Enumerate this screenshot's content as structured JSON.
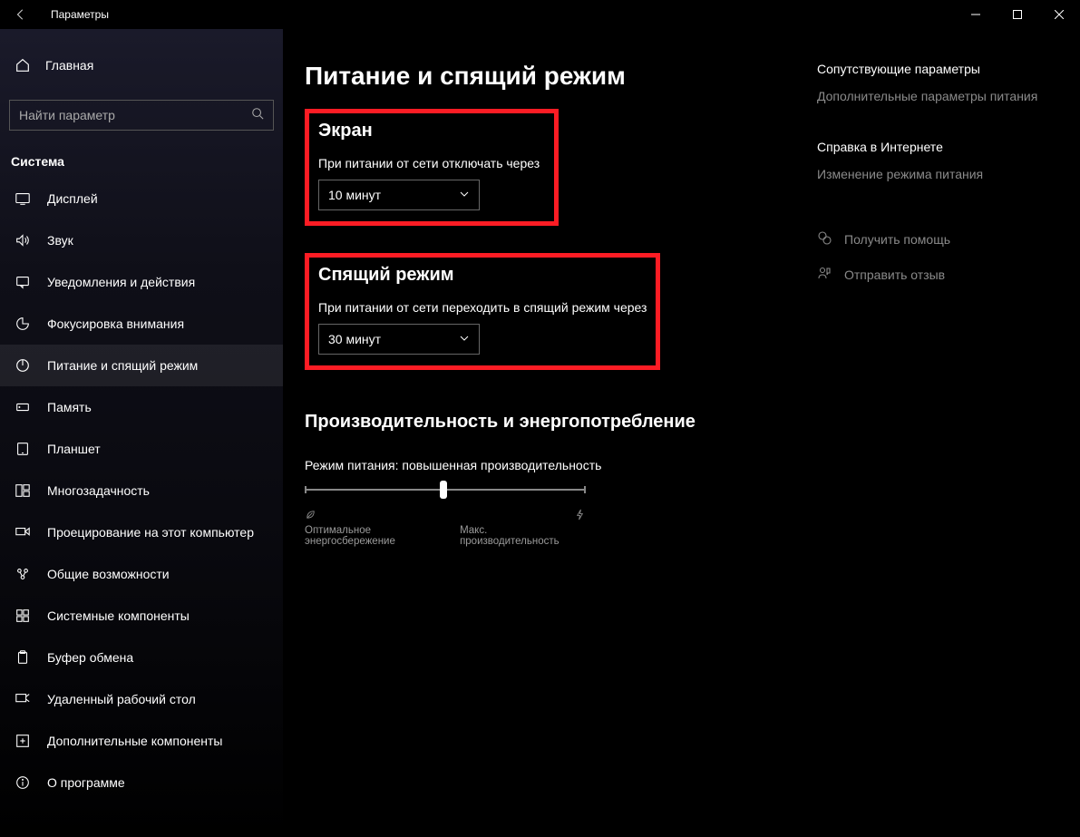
{
  "titlebar": {
    "title": "Параметры"
  },
  "sidebar": {
    "home": "Главная",
    "search_placeholder": "Найти параметр",
    "section": "Система",
    "items": [
      {
        "label": "Дисплей"
      },
      {
        "label": "Звук"
      },
      {
        "label": "Уведомления и действия"
      },
      {
        "label": "Фокусировка внимания"
      },
      {
        "label": "Питание и спящий режим"
      },
      {
        "label": "Память"
      },
      {
        "label": "Планшет"
      },
      {
        "label": "Многозадачность"
      },
      {
        "label": "Проецирование на этот компьютер"
      },
      {
        "label": "Общие возможности"
      },
      {
        "label": "Системные компоненты"
      },
      {
        "label": "Буфер обмена"
      },
      {
        "label": "Удаленный рабочий стол"
      },
      {
        "label": "Дополнительные компоненты"
      },
      {
        "label": "О программе"
      }
    ]
  },
  "page": {
    "title": "Питание и спящий режим",
    "screen": {
      "heading": "Экран",
      "label": "При питании от сети отключать через",
      "value": "10 минут"
    },
    "sleep": {
      "heading": "Спящий режим",
      "label": "При питании от сети переходить в спящий режим через",
      "value": "30 минут"
    },
    "perf": {
      "heading": "Производительность и энергопотребление",
      "mode_label": "Режим питания: повышенная производительность",
      "left_label": "Оптимальное энергосбережение",
      "right_label": "Макс. производительность"
    }
  },
  "right": {
    "related_heading": "Сопутствующие параметры",
    "related_link": "Дополнительные параметры питания",
    "help_heading": "Справка в Интернете",
    "help_link": "Изменение режима питания",
    "get_help": "Получить помощь",
    "feedback": "Отправить отзыв"
  }
}
